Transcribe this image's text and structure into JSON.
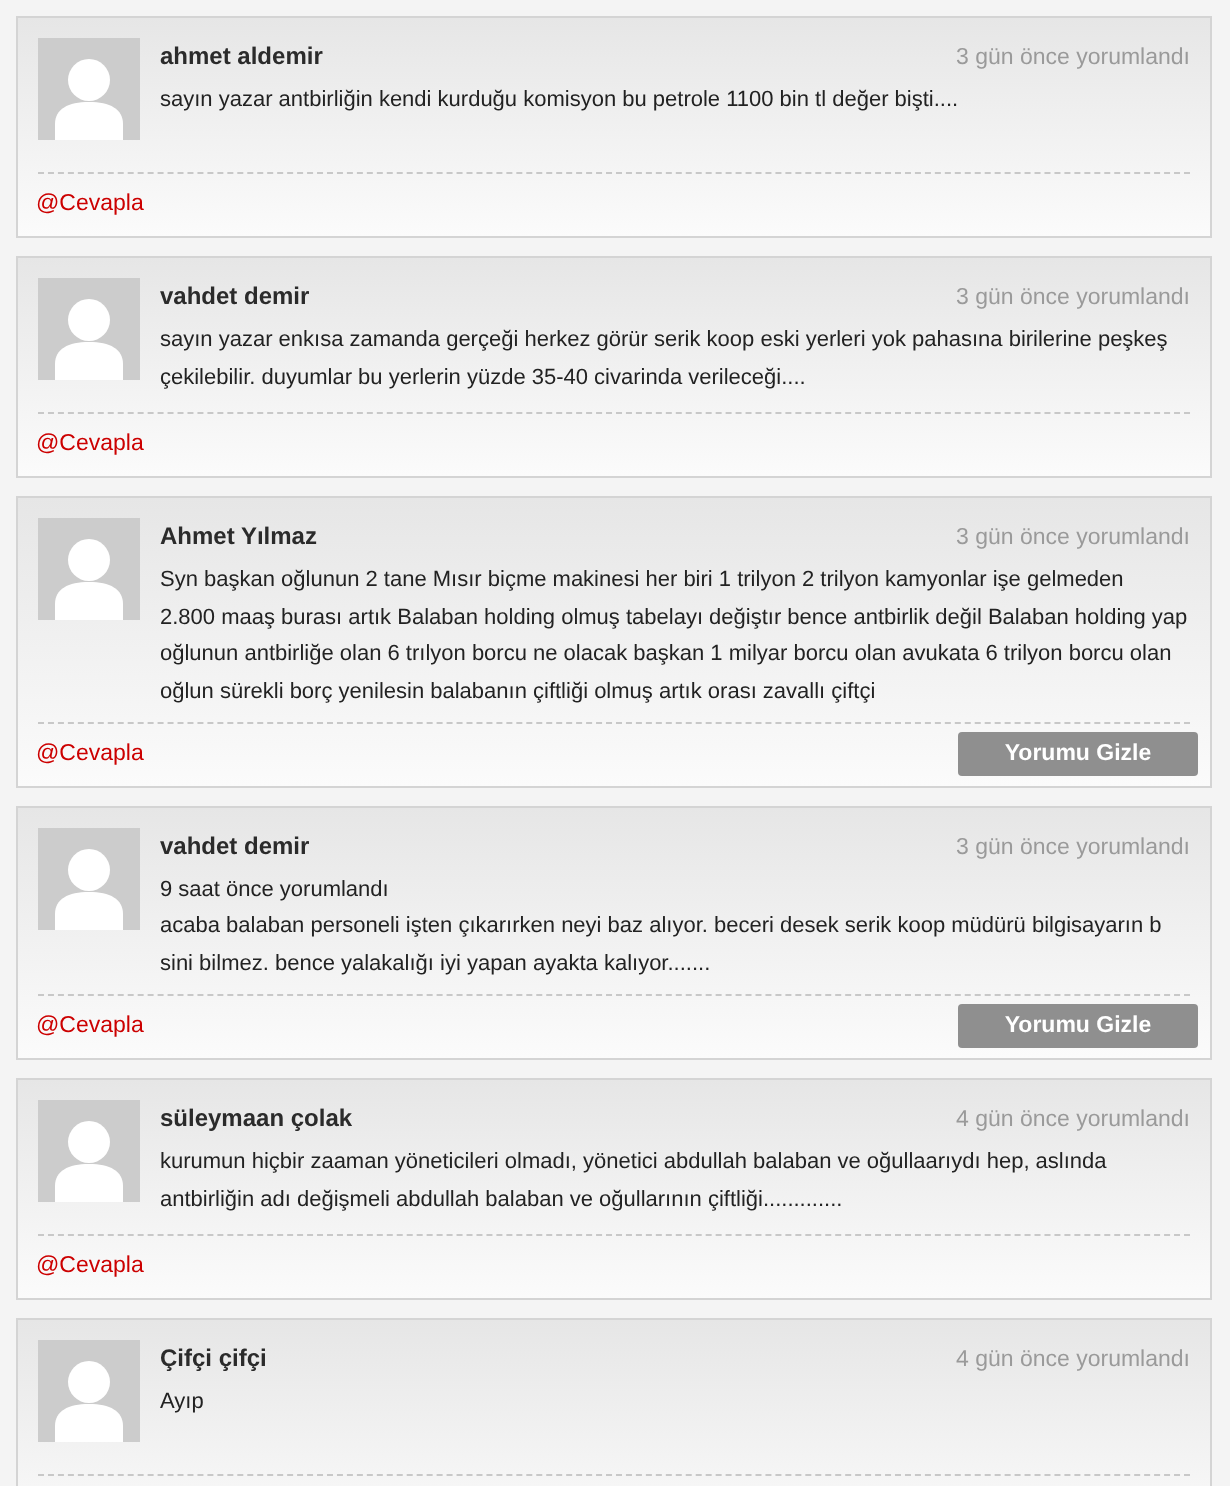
{
  "comments": [
    {
      "author": "ahmet aldemir",
      "time": "3 gün önce yorumlandı",
      "text": "sayın yazar antbirliğin kendi kurduğu komisyon bu petrole 1100 bin tl değer bişti....",
      "reply": "@Cevapla"
    },
    {
      "author": "vahdet demir",
      "time": "3 gün önce yorumlandı",
      "text": "sayın yazar enkısa zamanda gerçeği herkez görür serik koop eski yerleri yok pahasına birilerine peşkeş çekilebilir. duyumlar bu yerlerin yüzde 35-40 civarinda verileceği....",
      "reply": "@Cevapla"
    },
    {
      "author": "Ahmet Yılmaz",
      "time": "3 gün önce yorumlandı",
      "text": "Syn başkan oğlunun 2 tane Mısır biçme makinesi her biri 1 trilyon 2 trilyon kamyonlar işe gelmeden\n2.800 maaş burası artık Balaban holding olmuş tabelayı değiştır bence antbirlik değil Balaban holding yap oğlunun antbirliğe olan 6 trılyon borcu ne olacak başkan 1 milyar borcu olan avukata 6 trilyon borcu olan oğlun sürekli borç yenilesin balabanın çiftliği olmuş artık orası zavallı çiftçi",
      "reply": "@Cevapla",
      "hide_button": "Yorumu Gizle"
    },
    {
      "author": "vahdet demir",
      "time": "3 gün önce yorumlandı",
      "note": "9 saat önce yorumlandı",
      "text": "acaba balaban personeli işten çıkarırken neyi baz alıyor. beceri desek serik koop müdürü bilgisayarın b sini bilmez. bence yalakalığı iyi yapan ayakta kalıyor.......",
      "reply": "@Cevapla",
      "hide_button": "Yorumu Gizle"
    },
    {
      "author": "süleymaan çolak",
      "time": "4 gün önce yorumlandı",
      "text": "kurumun hiçbir zaaman yöneticileri olmadı, yönetici abdullah balaban ve oğullaarıydı hep, aslında antbirliğin adı değişmeli abdullah balaban ve oğullarının çiftliği.............",
      "reply": "@Cevapla"
    },
    {
      "author": "Çifçi çifçi",
      "time": "4 gün önce yorumlandı",
      "text": "Ayıp"
    }
  ]
}
